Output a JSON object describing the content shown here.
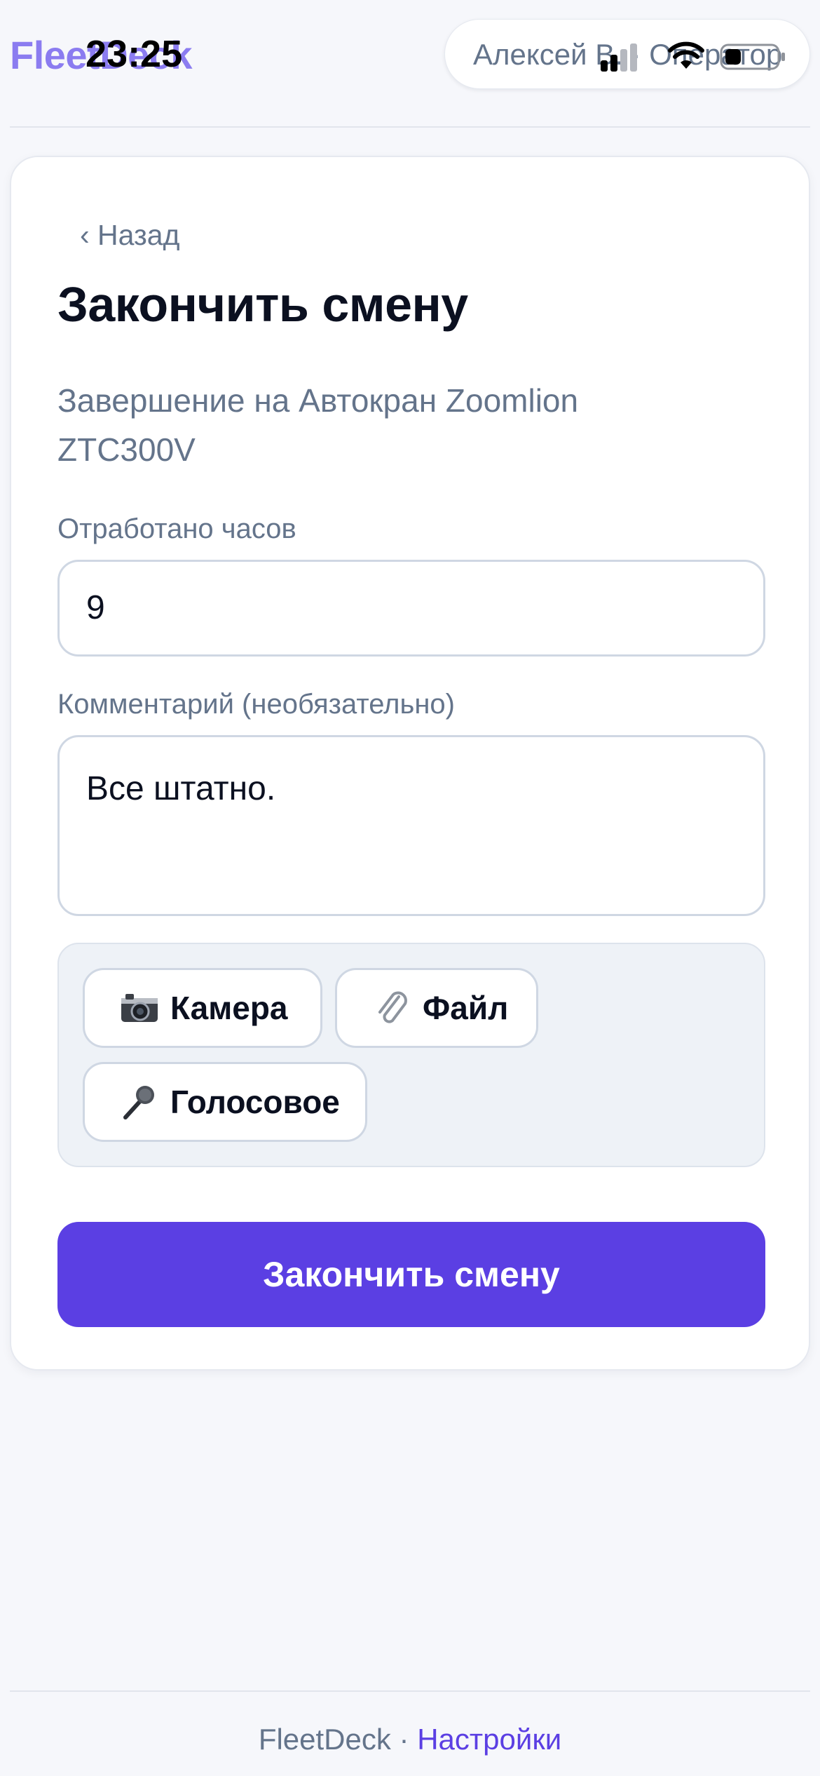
{
  "header": {
    "brand": "FleetDeck",
    "clock": "23:25",
    "user_label": "Алексей В. · Оператор"
  },
  "card": {
    "back_label": "‹ Назад",
    "title": "Закончить смену",
    "subtitle": "Завершение на Автокран Zoomlion ZTC300V",
    "hours_label": "Отработано часов",
    "hours_value": "9",
    "comment_label": "Комментарий (необязательно)",
    "comment_value": "Все штатно.",
    "attachments": {
      "camera_label": "Камера",
      "camera_icon": "camera-icon",
      "file_label": "Файл",
      "file_icon": "paperclip-icon",
      "voice_label": "Голосовое",
      "voice_icon": "microphone-icon"
    },
    "submit_label": "Закончить смену"
  },
  "footer": {
    "brand": "FleetDeck",
    "separator": "·",
    "settings_label": "Настройки"
  },
  "colors": {
    "accent": "#5b3fe3",
    "brand": "#8b7cf0",
    "muted_text": "#64748b",
    "background": "#f6f7fb"
  }
}
